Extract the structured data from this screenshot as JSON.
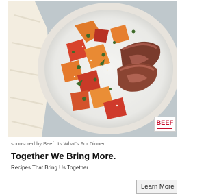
{
  "ad": {
    "sponsor_text": "sponsored by Beef. Its What's For Dinner.",
    "headline": "Together We Bring More.",
    "subline": "Recipes That Bring Us Together.",
    "cta_label": "Learn More",
    "logo_text": "BEEF",
    "image_subject": "plate of sliced steak with roasted sweet potatoes and red peppers",
    "colors": {
      "brand_red": "#c8102e",
      "cta_bg": "#f2f2f2"
    }
  }
}
